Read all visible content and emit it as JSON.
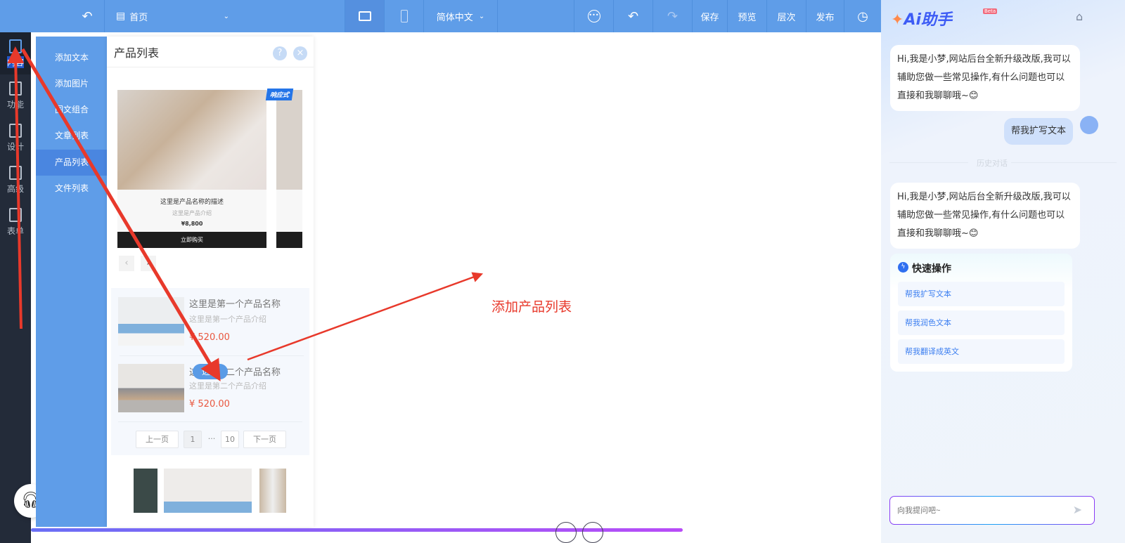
{
  "topbar": {
    "page_select": "首页",
    "language": "简体中文",
    "actions": [
      "保存",
      "预览",
      "层次",
      "发布"
    ]
  },
  "leftnav": [
    "内容",
    "功能",
    "设计",
    "高级",
    "表单"
  ],
  "menu": [
    "添加文本",
    "添加图片",
    "图文组合",
    "文章列表",
    "产品列表",
    "文件列表"
  ],
  "panel": {
    "title": "产品列表",
    "help": "?",
    "close": "×",
    "preview": {
      "badge": "响应式",
      "name": "这里是产品名称的描述",
      "desc": "这里是产品介绍",
      "price": "¥8,800",
      "buy": "立即购买"
    },
    "products": [
      {
        "name": "这里是第一个产品名称",
        "desc": "这里是第一个产品介绍",
        "price": "¥ 520.00"
      },
      {
        "name": "这里是第二个产品名称",
        "desc": "这里是第二个产品介绍",
        "price": "¥ 520.00"
      }
    ],
    "select_label": "选择",
    "pagination": {
      "prev": "上一页",
      "current": "1",
      "ellipsis": "···",
      "last": "10",
      "next": "下一页"
    }
  },
  "annotation": "添加产品列表",
  "ai": {
    "title": "Ai助手",
    "beta": "Beta",
    "greeting": "Hi,我是小梦,网站后台全新升级改版,我可以辅助您做一些常见操作,有什么问题也可以直接和我聊聊哦~😊",
    "user_msg": "帮我扩写文本",
    "history": "历史对话",
    "quick_title": "快速操作",
    "quick": [
      "帮我扩写文本",
      "帮我润色文本",
      "帮我翻译成英文"
    ],
    "input_placeholder": "向我提问吧~"
  }
}
